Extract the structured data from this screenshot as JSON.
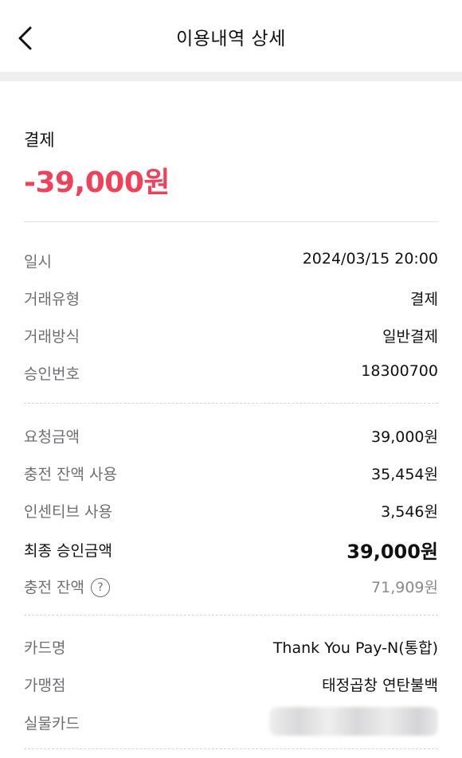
{
  "header": {
    "title": "이용내역 상세"
  },
  "transaction": {
    "type": "결제",
    "amount": "-39,000원"
  },
  "details": [
    {
      "label": "일시",
      "value": "2024/03/15 20:00"
    },
    {
      "label": "거래유형",
      "value": "결제"
    },
    {
      "label": "거래방식",
      "value": "일반결제"
    },
    {
      "label": "승인번호",
      "value": "18300700"
    }
  ],
  "amounts": [
    {
      "label": "요청금액",
      "value": "39,000원"
    },
    {
      "label": "충전 잔액 사용",
      "value": "35,454원"
    },
    {
      "label": "인센티브 사용",
      "value": "3,546원"
    },
    {
      "label": "최종 승인금액",
      "value": "39,000원"
    },
    {
      "label": "충전 잔액",
      "value": "71,909원"
    }
  ],
  "card": [
    {
      "label": "카드명",
      "value": "Thank You Pay-N(통합)"
    },
    {
      "label": "가맹점",
      "value": "태정곱창 연탄불백"
    },
    {
      "label": "실물카드",
      "value": ""
    }
  ],
  "icons": {
    "back": "chevron-left-icon",
    "help": "question-circle-icon"
  },
  "colors": {
    "amount": "#f0415a",
    "muted": "#6e6e73"
  }
}
